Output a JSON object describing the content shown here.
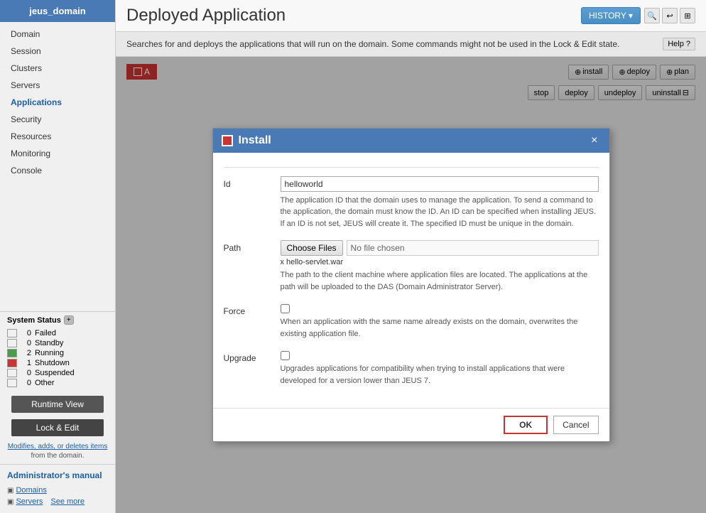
{
  "header": {
    "title": "Deployed Application",
    "history_btn": "HISTORY ▾"
  },
  "sidebar": {
    "domain_name": "jeus_domain",
    "nav_items": [
      {
        "label": "Domain",
        "active": false
      },
      {
        "label": "Session",
        "active": false
      },
      {
        "label": "Clusters",
        "active": false
      },
      {
        "label": "Servers",
        "active": false
      },
      {
        "label": "Applications",
        "active": true
      },
      {
        "label": "Security",
        "active": false
      },
      {
        "label": "Resources",
        "active": false
      },
      {
        "label": "Monitoring",
        "active": false
      },
      {
        "label": "Console",
        "active": false
      }
    ],
    "system_status_label": "System Status",
    "status_rows": [
      {
        "label": "Failed",
        "count": "0",
        "type": "failed"
      },
      {
        "label": "Standby",
        "count": "0",
        "type": "standby"
      },
      {
        "label": "Running",
        "count": "2",
        "type": "running"
      },
      {
        "label": "Shutdown",
        "count": "1",
        "type": "shutdown"
      },
      {
        "label": "Suspended",
        "count": "0",
        "type": "suspended"
      },
      {
        "label": "Other",
        "count": "0",
        "type": "other"
      }
    ],
    "runtime_view_btn": "Runtime View",
    "lock_edit_btn": "Lock & Edit",
    "note_text": "Modifies, adds, or deletes items from the domain.",
    "admin_title": "Administrator's manual",
    "admin_links": [
      {
        "label": "Domains"
      },
      {
        "label": "Servers"
      },
      {
        "label": "See more"
      }
    ]
  },
  "info_bar": {
    "text": "Searches for and deploys the applications that will run on the domain. Some commands might not be used in the Lock & Edit state.",
    "help_btn": "Help ?"
  },
  "toolbar": {
    "tab_label": "A",
    "install_btn": "install",
    "deploy_btn": "deploy",
    "plan_btn": "plan",
    "stop_btn": "stop",
    "deploy2_btn": "deploy",
    "undeploy_btn": "undeploy",
    "uninstall_btn": "uninstall"
  },
  "modal": {
    "title": "Install",
    "close_btn": "×",
    "fields": {
      "id": {
        "label": "Id",
        "value": "helloworld",
        "description": "The application ID that the domain uses to manage the application. To send a command to the application, the domain must know the ID. An ID can be specified when installing JEUS. If an ID is not set, JEUS will create it. The specified ID must be unique in the domain."
      },
      "path": {
        "label": "Path",
        "choose_btn": "Choose Files",
        "placeholder": "No file chosen",
        "file_selected": "x hello-servlet.war",
        "description": "The path to the client machine where application files are located. The applications at the path will be uploaded to the DAS (Domain Administrator Server)."
      },
      "force": {
        "label": "Force",
        "description": "When an application with the same name already exists on the domain, overwrites the existing application file."
      },
      "upgrade": {
        "label": "Upgrade",
        "description": "Upgrades applications for compatibility when trying to install applications that were developed for a version lower than JEUS 7."
      }
    },
    "ok_btn": "OK",
    "cancel_btn": "Cancel"
  }
}
